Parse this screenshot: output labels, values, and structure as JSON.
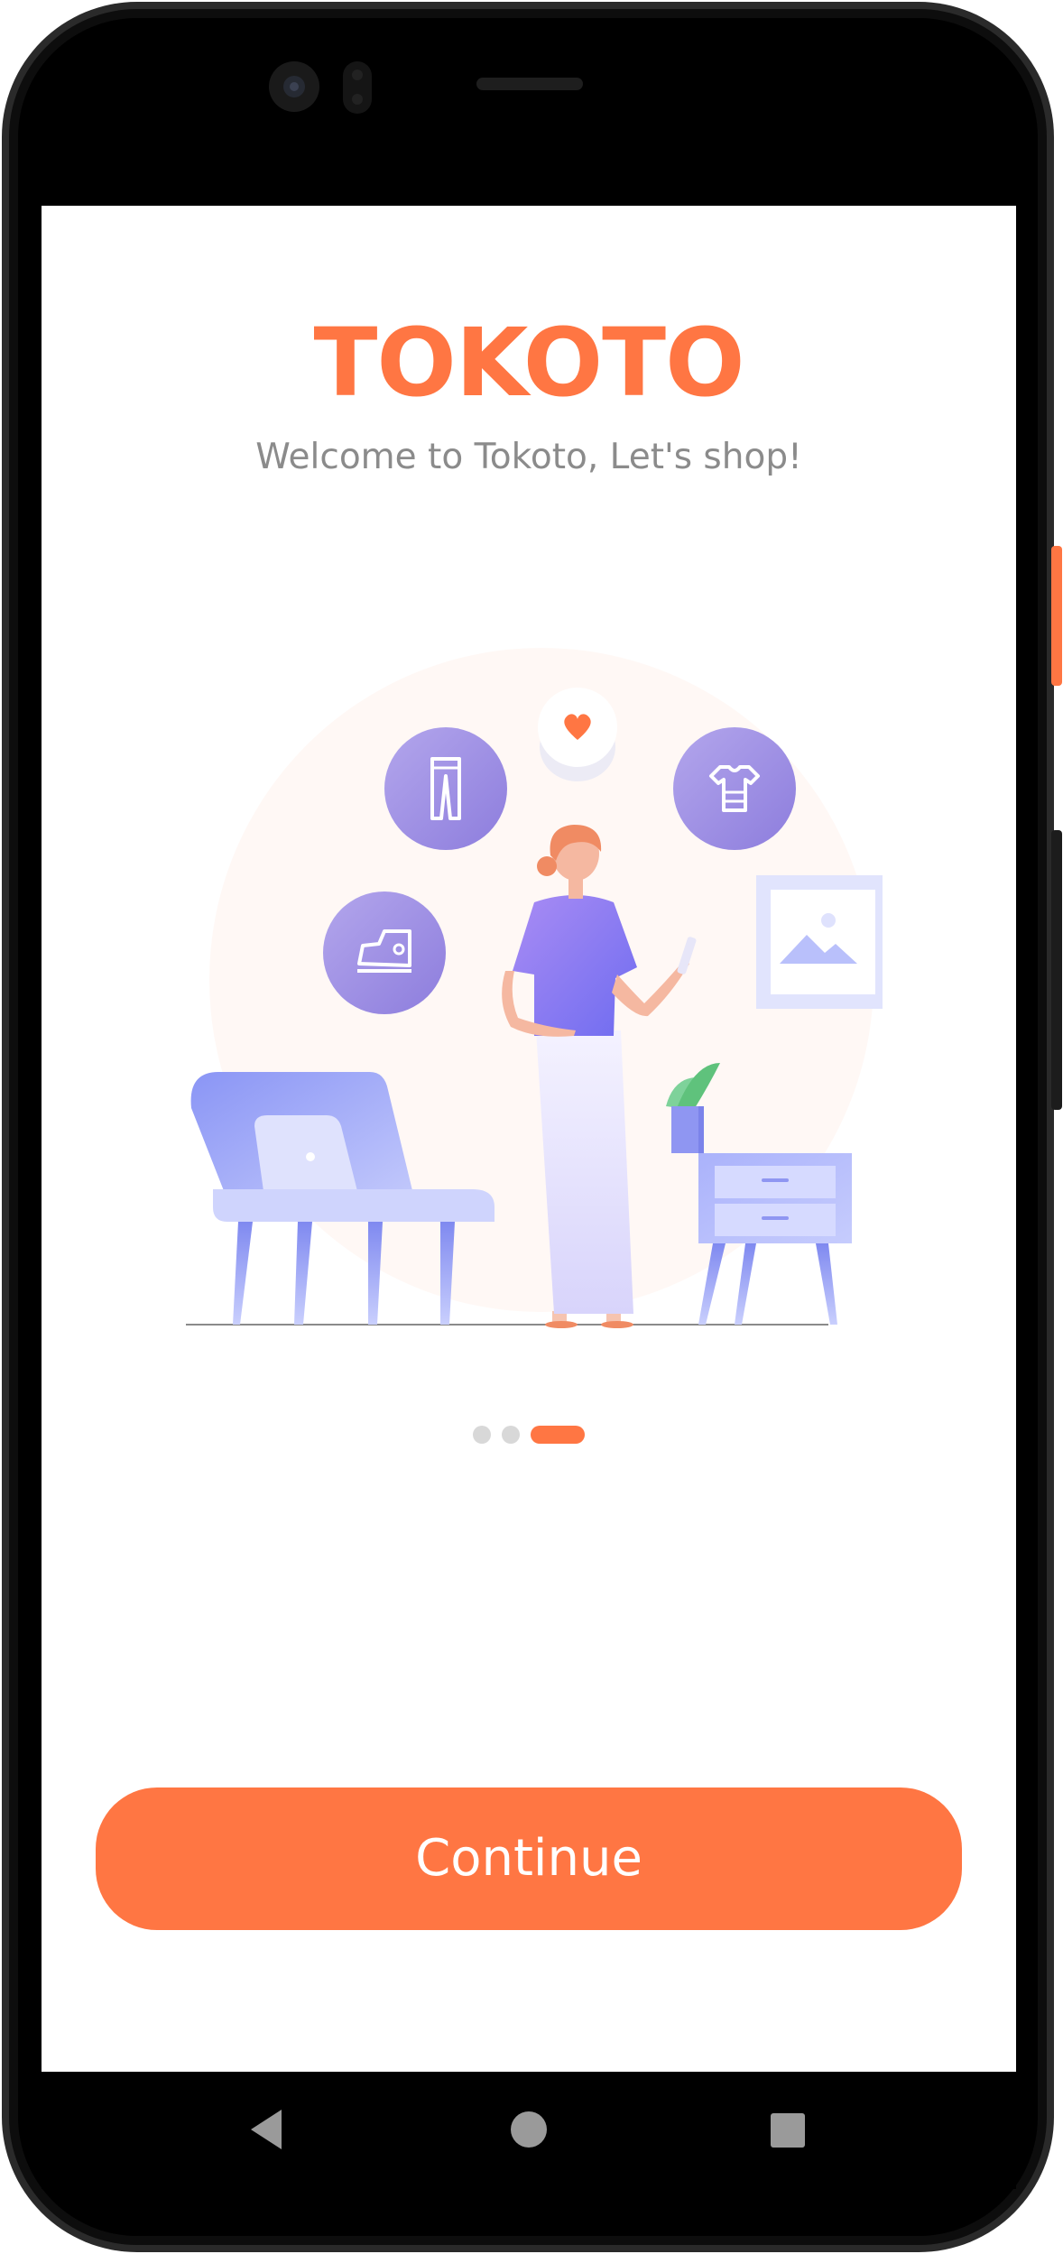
{
  "app": {
    "title": "TOKOTO",
    "subtitle": "Welcome to Tokoto, Let's shop!"
  },
  "pagination": {
    "total": 3,
    "active_index": 2
  },
  "actions": {
    "continue_label": "Continue"
  },
  "illustration": {
    "icons": [
      "pants-icon",
      "heart-icon",
      "shirt-icon",
      "sneaker-icon",
      "picture-frame-icon"
    ]
  },
  "navigation": {
    "buttons": [
      "back-nav-icon",
      "home-nav-icon",
      "recents-nav-icon"
    ]
  },
  "colors": {
    "accent": "#FF7643",
    "subtitle": "#8B8B8B",
    "dot_inactive": "#D8D8D8",
    "icon_circle": "#9C8EE0",
    "person_shirt": "#7E73EE",
    "backdrop": "#FFF8F5"
  }
}
